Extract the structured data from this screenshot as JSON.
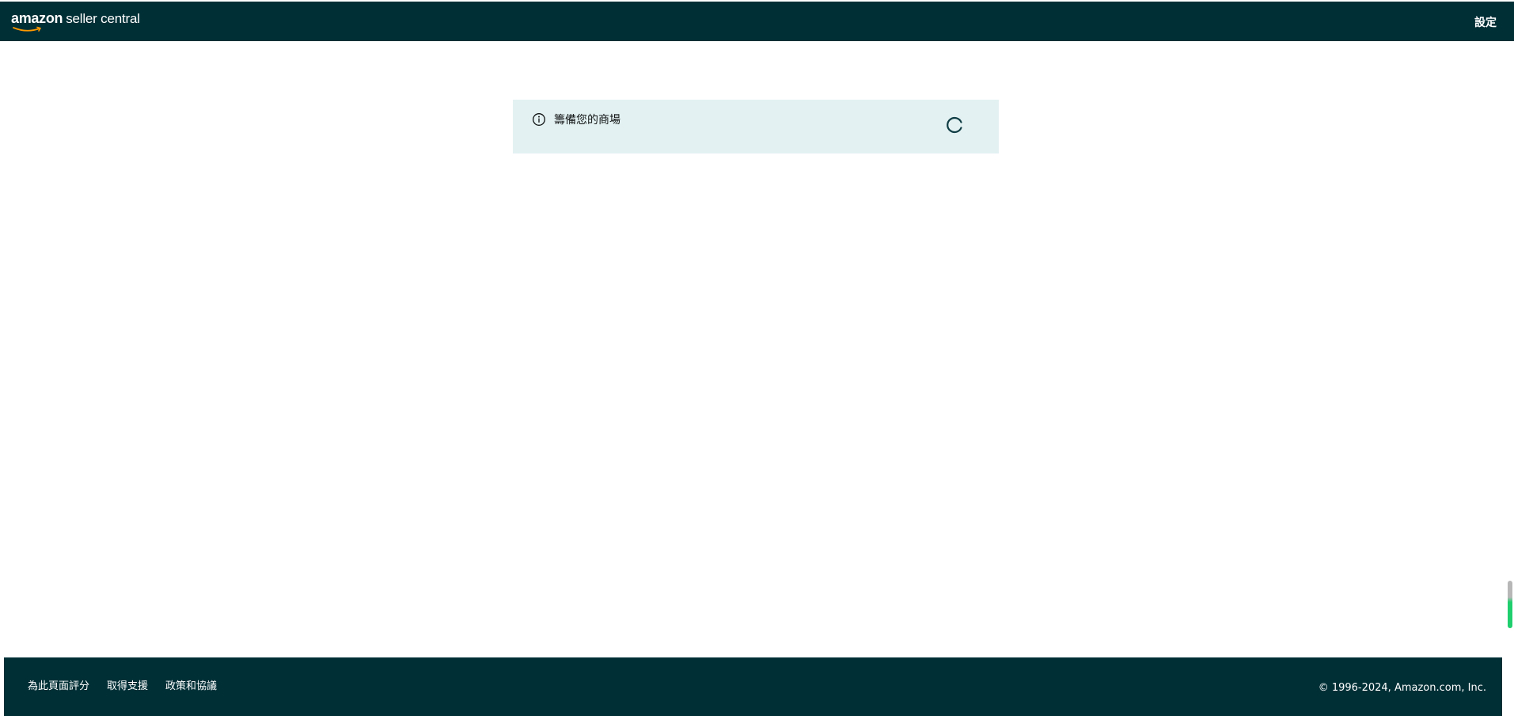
{
  "header": {
    "logo_brand": "amazon",
    "logo_suffix": "seller central",
    "settings_label": "設定"
  },
  "notice": {
    "message": "籌備您的商場",
    "icon": "info-icon",
    "status_icon": "loading-spinner-icon"
  },
  "footer": {
    "links": [
      "為此頁面評分",
      "取得支援",
      "政策和協議"
    ],
    "copyright": "© 1996-2024, Amazon.com, Inc."
  },
  "colors": {
    "header_bg": "#002f36",
    "footer_bg": "#002f36",
    "notice_bg": "#e3f1f2",
    "logo_smile": "#ff9900",
    "scroll_indicator": "#1fcf6e"
  }
}
